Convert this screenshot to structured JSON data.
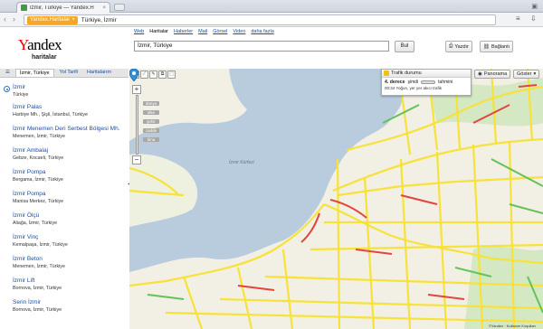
{
  "browser": {
    "tab_title": "İzmir, Türkiye — Yandex.H",
    "tab_close": "×",
    "address_chip": "Yandex.Haritalar",
    "address_chip_close": "×",
    "address_text": "Türkiye, İzmir"
  },
  "header": {
    "logo": "Yandex",
    "logo_sub": "haritalar",
    "services": [
      "Web",
      "Haritalar",
      "Haberler",
      "Mail",
      "Görsel",
      "Video",
      "daha fazla"
    ],
    "active_service_index": 1,
    "search_value": "İzmir, Türkiye",
    "search_button": "Bul",
    "print_button": "Yazdır",
    "link_button": "Bağlantı"
  },
  "left_panel": {
    "tabs": [
      "İzmir, Türkiye",
      "Yol Tarifi",
      "Haritalarım"
    ],
    "active_tab_index": 0,
    "results": [
      {
        "title": "İzmir",
        "address": "Türkiye"
      },
      {
        "title": "İzmir Palas",
        "address": "Harbiye Mh., Şişli, İstanbul, Türkiye"
      },
      {
        "title": "İzmir Menemen Deri Serbest Bölgesi Mh.",
        "address": "Menemen, İzmir, Türkiye"
      },
      {
        "title": "İzmir Ambalaj",
        "address": "Gebze, Kocaeli, Türkiye"
      },
      {
        "title": "İzmir Pompa",
        "address": "Bergama, İzmir, Türkiye"
      },
      {
        "title": "İzmir Pompa",
        "address": "Manisa Merkez, Türkiye"
      },
      {
        "title": "İzmir Ölçü",
        "address": "Aliağa, İzmir, Türkiye"
      },
      {
        "title": "İzmir Vinç",
        "address": "Kemalpaşa, İzmir, Türkiye"
      },
      {
        "title": "İzmir Beton",
        "address": "Menemen, İzmir, Türkiye"
      },
      {
        "title": "İzmir Lift",
        "address": "Bornova, İzmir, Türkiye"
      },
      {
        "title": "Serin İzmir",
        "address": "Bornova, İzmir, Türkiye"
      }
    ]
  },
  "map": {
    "zoom_labels": [
      "dünya",
      "ülke",
      "şehir",
      "cadde",
      "bina"
    ],
    "water_label": "İzmir Körfezi",
    "traffic": {
      "title": "Trafik durumu",
      "level": "4. derece",
      "mode_now": "şimdi",
      "mode_forecast": "tahmini",
      "note": "00:34 Yoğun, yer yer akıcı trafik"
    },
    "panorama_button": "Panorama",
    "layers_button": "Göster",
    "copyright": "©Yandex · Kullanım Koşulları"
  },
  "colors": {
    "traffic_yellow": "#f7e23a",
    "traffic_red": "#e2453c",
    "traffic_green": "#63c25a",
    "water": "#b9ccdd",
    "land": "#f2efe4",
    "yandex_red": "#e00000",
    "link_blue": "#1c4fa3"
  },
  "icons": {
    "favicon": "yandex-maps-icon",
    "pin": "map-pin-icon",
    "traffic_light": "traffic-light-icon",
    "print": "printer-icon",
    "link": "chain-link-icon"
  }
}
